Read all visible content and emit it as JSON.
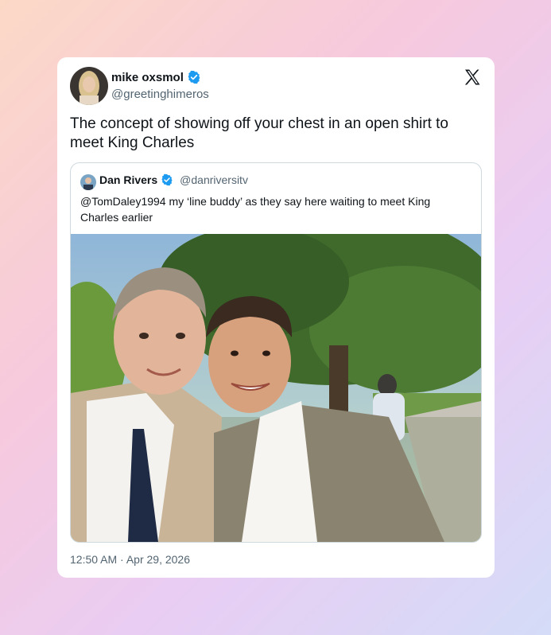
{
  "tweet": {
    "author_name": "mike oxsmol",
    "author_handle": "@greetinghimeros",
    "text": "The concept of showing off your chest in an open shirt to meet King Charles",
    "timestamp": "12:50 AM · Apr 29, 2026",
    "verified_color": "#1d9bf0",
    "platform_icon": "x-logo-icon"
  },
  "quoted_tweet": {
    "author_name": "Dan Rivers",
    "author_handle": "@danriversitv",
    "text": "@TomDaley1994 my ‘line buddy’ as they say here waiting to meet King Charles earlier",
    "photo": "selfie-photo"
  },
  "colors": {
    "text_primary": "#0f1419",
    "text_secondary": "#536471",
    "border": "#cfd9de"
  }
}
